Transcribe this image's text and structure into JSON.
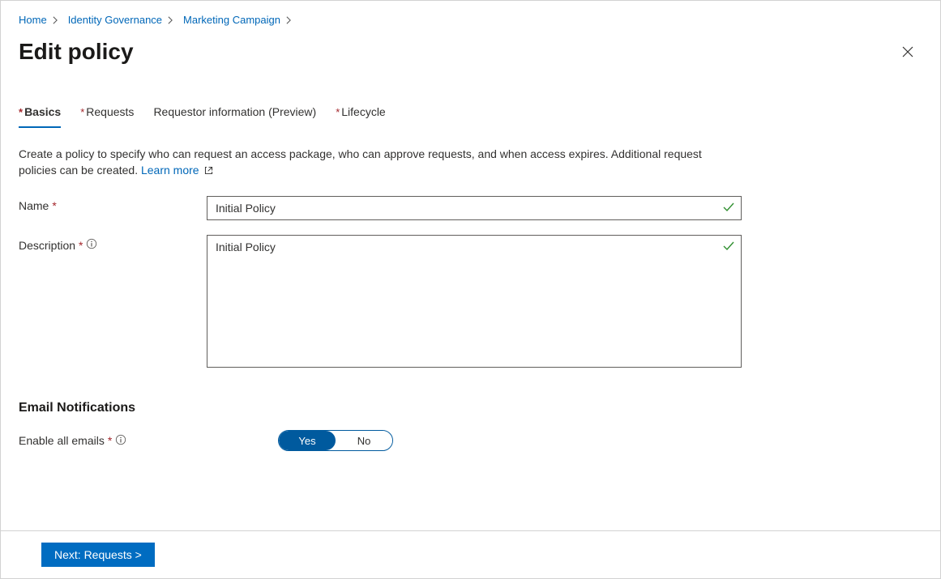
{
  "breadcrumb": [
    "Home",
    "Identity Governance",
    "Marketing Campaign"
  ],
  "title": "Edit policy",
  "tabs": [
    {
      "label": "Basics",
      "required": true,
      "active": true
    },
    {
      "label": "Requests",
      "required": true,
      "active": false
    },
    {
      "label": "Requestor information (Preview)",
      "required": false,
      "active": false
    },
    {
      "label": "Lifecycle",
      "required": true,
      "active": false
    }
  ],
  "description": "Create a policy to specify who can request an access package, who can approve requests, and when access expires. Additional request policies can be created. ",
  "learn_more": "Learn more",
  "fields": {
    "name": {
      "label": "Name",
      "value": "Initial Policy"
    },
    "description": {
      "label": "Description",
      "value": "Initial Policy"
    }
  },
  "section_title": "Email Notifications",
  "enable_emails": {
    "label": "Enable all emails",
    "options": {
      "yes": "Yes",
      "no": "No"
    },
    "value": "yes"
  },
  "next_button": "Next: Requests >"
}
